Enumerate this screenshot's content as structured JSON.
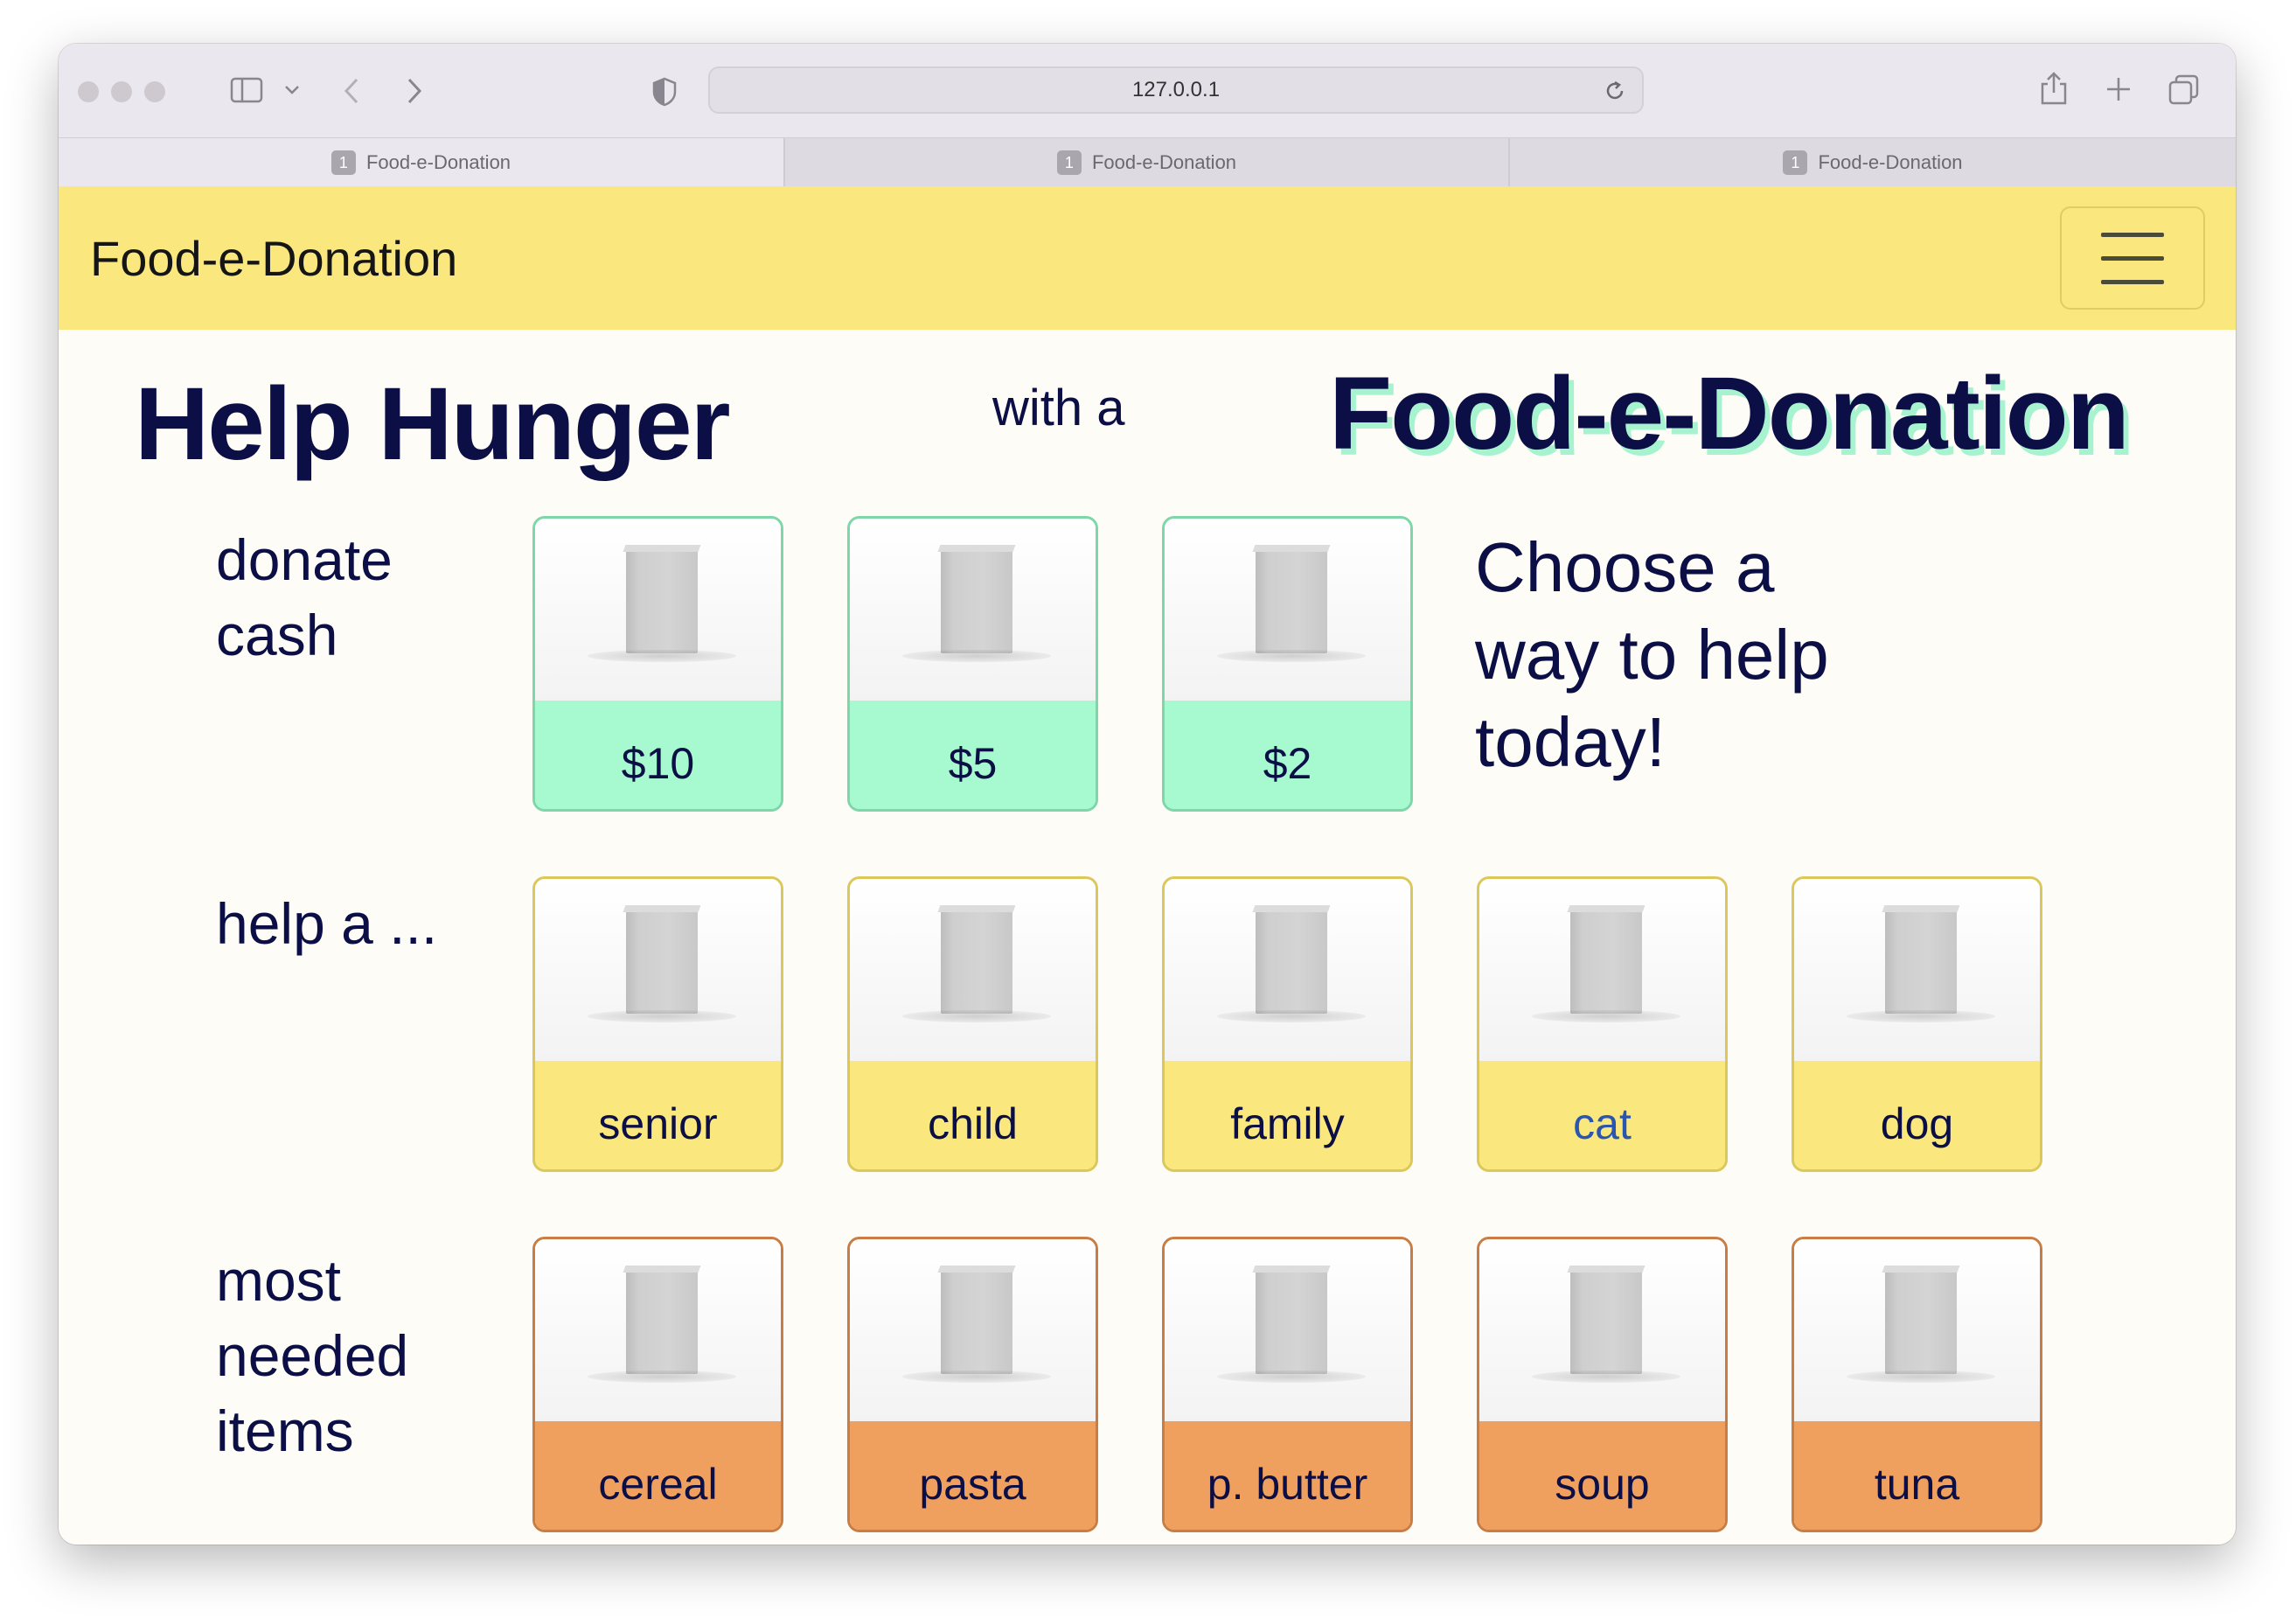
{
  "browser": {
    "url": "127.0.0.1",
    "tabs": [
      {
        "number": "1",
        "title": "Food-e-Donation"
      },
      {
        "number": "1",
        "title": "Food-e-Donation"
      },
      {
        "number": "1",
        "title": "Food-e-Donation"
      }
    ]
  },
  "navbar": {
    "brand": "Food-e-Donation"
  },
  "hero": {
    "part1": "Help Hunger",
    "part2": "with a",
    "part3": "Food-e-Donation"
  },
  "rows": {
    "cash": {
      "label": "donate cash",
      "items": [
        "$10",
        "$5",
        "$2"
      ]
    },
    "help": {
      "label": "help a ...",
      "items": [
        "senior",
        "child",
        "family",
        "cat",
        "dog"
      ]
    },
    "needed": {
      "label": "most needed items",
      "items": [
        "cereal",
        "pasta",
        "p. butter",
        "soup",
        "tuna"
      ]
    }
  },
  "choose_text": "Choose a way to help today!",
  "colors": {
    "cash": "#a7f9d0",
    "help": "#fae87f",
    "needed": "#efa05f",
    "navbar": "#fae87f",
    "heading": "#0b0f45"
  }
}
